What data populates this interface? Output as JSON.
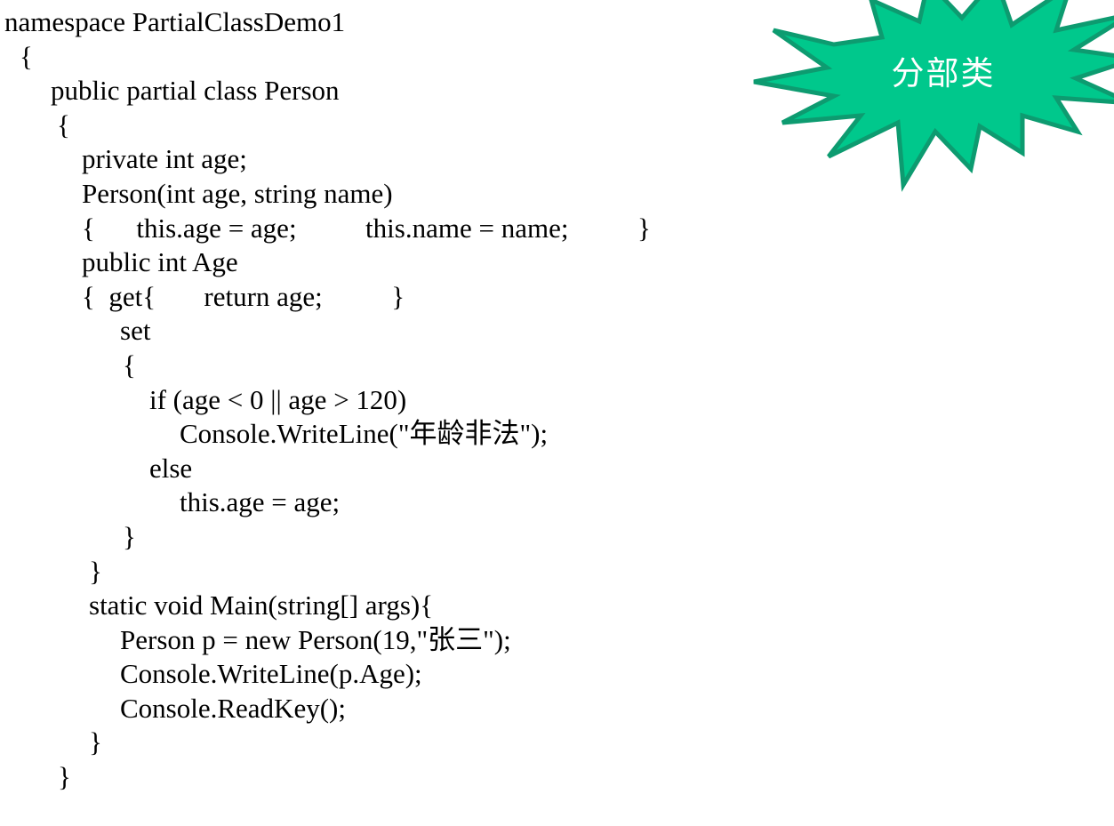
{
  "slide": {
    "background_color": "#ffffff",
    "text_color": "#000000"
  },
  "callout": {
    "shape": "explosion-starburst",
    "label": "分部类",
    "fill_color": "#00C88C",
    "border_color": "#0D9B70",
    "text_color": "#ffffff"
  },
  "code": {
    "language": "csharp",
    "lines": [
      {
        "id": "line-1",
        "indent": "i0",
        "text": "namespace PartialClassDemo1"
      },
      {
        "id": "line-2",
        "indent": "i1",
        "text": "{"
      },
      {
        "id": "line-3",
        "indent": "i2",
        "text": "public partial class Person"
      },
      {
        "id": "line-4",
        "indent": "i3",
        "text": "{"
      },
      {
        "id": "line-5",
        "indent": "i4",
        "text": "private int age;"
      },
      {
        "id": "line-6",
        "indent": "i4",
        "text": "Person(int age, string name)"
      },
      {
        "id": "line-7",
        "indent": "i4",
        "text": "{      this.age = age;          this.name = name;          }"
      },
      {
        "id": "line-8",
        "indent": "i4",
        "text": "public int Age"
      },
      {
        "id": "line-9",
        "indent": "i4",
        "text": "{  get{       return age;          }"
      },
      {
        "id": "line-10",
        "indent": "i6",
        "text": "set"
      },
      {
        "id": "line-11",
        "indent": "i7",
        "text": "{"
      },
      {
        "id": "line-12",
        "indent": "i8",
        "text": "if (age < 0 || age > 120)"
      },
      {
        "id": "line-13",
        "indent": "i9",
        "text": "Console.WriteLine(\"年龄非法\");"
      },
      {
        "id": "line-14",
        "indent": "i8",
        "text": "else"
      },
      {
        "id": "line-15",
        "indent": "i9",
        "text": "this.age = age;"
      },
      {
        "id": "line-16",
        "indent": "i7",
        "text": "}"
      },
      {
        "id": "line-17",
        "indent": "i5",
        "text": "}"
      },
      {
        "id": "line-18",
        "indent": "i5",
        "text": "static void Main(string[] args){"
      },
      {
        "id": "line-19",
        "indent": "i6",
        "text": "Person p = new Person(19,\"张三\");"
      },
      {
        "id": "line-20",
        "indent": "i6",
        "text": "Console.WriteLine(p.Age);"
      },
      {
        "id": "line-21",
        "indent": "i6",
        "text": "Console.ReadKey();"
      },
      {
        "id": "line-22",
        "indent": "i5",
        "text": "}"
      },
      {
        "id": "line-23",
        "indent": "i10",
        "text": "}"
      }
    ]
  }
}
